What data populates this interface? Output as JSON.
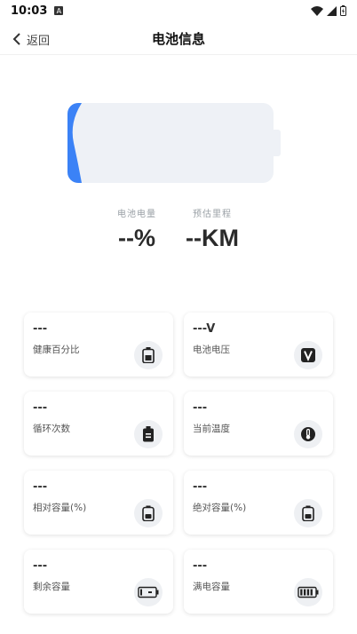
{
  "status_bar": {
    "time": "10:03",
    "notif_icon": "A"
  },
  "header": {
    "back_label": "返回",
    "title": "电池信息"
  },
  "battery": {
    "level_fraction": 0.06,
    "fill_color": "#3b82f6",
    "body_color": "#eef1f6"
  },
  "stats": [
    {
      "label": "电池电量",
      "value": "--%"
    },
    {
      "label": "预估里程",
      "value": "--KM"
    }
  ],
  "cards": [
    {
      "value": "---",
      "label": "健康百分比",
      "icon": "battery-health-icon"
    },
    {
      "value": "---V",
      "label": "电池电压",
      "icon": "voltage-icon"
    },
    {
      "value": "---",
      "label": "循环次数",
      "icon": "battery-cycle-icon"
    },
    {
      "value": "---",
      "label": "当前温度",
      "icon": "thermometer-icon"
    },
    {
      "value": "---",
      "label": "相对容量(%)",
      "icon": "battery-capacity-icon"
    },
    {
      "value": "---",
      "label": "绝对容量(%)",
      "icon": "battery-capacity-icon"
    },
    {
      "value": "---",
      "label": "剩余容量",
      "icon": "battery-remaining-icon"
    },
    {
      "value": "---",
      "label": "满电容量",
      "icon": "battery-full-icon"
    }
  ]
}
